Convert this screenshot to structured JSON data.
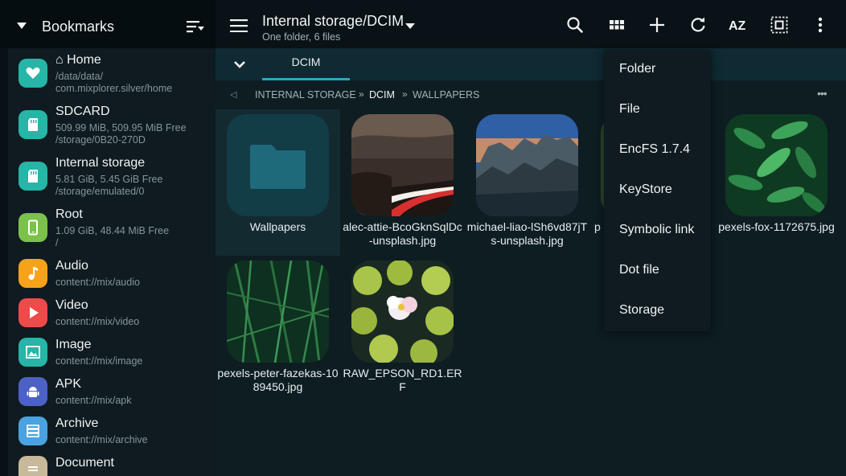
{
  "sidebar": {
    "title": "Bookmarks",
    "items": [
      {
        "name": "⌂ Home",
        "sub1": "/data/data/",
        "sub2": "com.mixplorer.silver/home",
        "icon": "heart-icon",
        "color": "#26b5a6"
      },
      {
        "name": "SDCARD",
        "sub1": "509.99 MiB,  509.95 MiB Free",
        "sub2": "/storage/0B20-270D",
        "icon": "sdcard-icon",
        "color": "#26b5a6"
      },
      {
        "name": "Internal storage",
        "sub1": "5.81 GiB,  5.45 GiB Free",
        "sub2": "/storage/emulated/0",
        "icon": "sdcard-icon",
        "color": "#26b5a6"
      },
      {
        "name": "Root",
        "sub1": "1.09 GiB,  48.44 MiB Free",
        "sub2": "/",
        "icon": "phone-icon",
        "color": "#7cc14a"
      },
      {
        "name": "Audio",
        "sub1": "content://mix/audio",
        "icon": "music-note-icon",
        "color": "#f6a21a"
      },
      {
        "name": "Video",
        "sub1": "content://mix/video",
        "icon": "play-icon",
        "color": "#ef4a4a"
      },
      {
        "name": "Image",
        "sub1": "content://mix/image",
        "icon": "image-icon",
        "color": "#26b5a6"
      },
      {
        "name": "APK",
        "sub1": "content://mix/apk",
        "icon": "android-icon",
        "color": "#4b62c4"
      },
      {
        "name": "Archive",
        "sub1": "content://mix/archive",
        "icon": "archive-icon",
        "color": "#4aa3e0"
      },
      {
        "name": "Document",
        "icon": "document-icon",
        "color": "#c8b99a"
      }
    ]
  },
  "header": {
    "title": "Internal storage/DCIM",
    "subtitle": "One folder, 6 files",
    "az_label": "AZ"
  },
  "tabs": [
    {
      "label": "DCIM"
    }
  ],
  "breadcrumb": {
    "items": [
      "INTERNAL STORAGE",
      "DCIM",
      "WALLPAPERS"
    ],
    "separator": "»",
    "back_glyph": "◁",
    "more_glyph": "•••"
  },
  "grid": {
    "items": [
      {
        "name": "Wallpapers",
        "kind": "folder"
      },
      {
        "name": "alec-attie-BcoGknSqlDc-unsplash.jpg",
        "kind": "image"
      },
      {
        "name": "michael-liao-lSh6vd87jTs-unsplash.jpg",
        "kind": "image"
      },
      {
        "name": "p",
        "kind": "image"
      },
      {
        "name": "pexels-fox-1172675.jpg",
        "kind": "image"
      },
      {
        "name": "pexels-peter-fazekas-1089450.jpg",
        "kind": "image"
      },
      {
        "name": "RAW_EPSON_RD1.ERF",
        "kind": "image"
      }
    ]
  },
  "popup_menu": {
    "items": [
      "Folder",
      "File",
      "EncFS 1.7.4",
      "KeyStore",
      "Symbolic link",
      "Dot file",
      "Storage"
    ]
  },
  "colors": {
    "accent": "#2ba6c0",
    "background": "#0e1d22",
    "sidebar": "#0f1b20"
  }
}
